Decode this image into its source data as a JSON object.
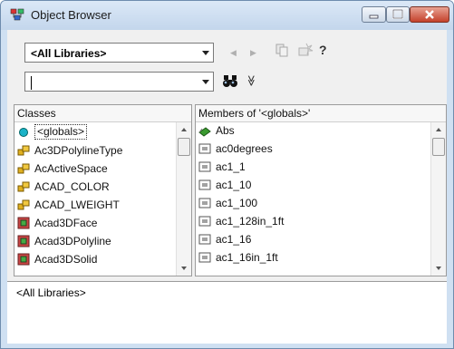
{
  "window": {
    "title": "Object Browser"
  },
  "toolbar": {
    "library_select": "<All Libraries>",
    "search_value": "",
    "back_glyph": "◀",
    "forward_glyph": "▶",
    "copy_icon": "copy-icon",
    "view_definition_icon": "view-definition-icon",
    "help_glyph": "?",
    "search_icon": "binoculars-icon",
    "toggle_glyph": "≫"
  },
  "classes": {
    "header": "Classes",
    "items": [
      {
        "label": "<globals>",
        "icon": "globals-icon"
      },
      {
        "label": "Ac3DPolylineType",
        "icon": "enum-icon"
      },
      {
        "label": "AcActiveSpace",
        "icon": "enum-icon"
      },
      {
        "label": "ACAD_COLOR",
        "icon": "enum-icon"
      },
      {
        "label": "ACAD_LWEIGHT",
        "icon": "enum-icon"
      },
      {
        "label": "Acad3DFace",
        "icon": "class-icon"
      },
      {
        "label": "Acad3DPolyline",
        "icon": "class-icon"
      },
      {
        "label": "Acad3DSolid",
        "icon": "class-icon"
      }
    ]
  },
  "members": {
    "header": "Members of '<globals>'",
    "items": [
      {
        "label": "Abs",
        "icon": "method-icon"
      },
      {
        "label": "ac0degrees",
        "icon": "constant-icon"
      },
      {
        "label": "ac1_1",
        "icon": "constant-icon"
      },
      {
        "label": "ac1_10",
        "icon": "constant-icon"
      },
      {
        "label": "ac1_100",
        "icon": "constant-icon"
      },
      {
        "label": "ac1_128in_1ft",
        "icon": "constant-icon"
      },
      {
        "label": "ac1_16",
        "icon": "constant-icon"
      },
      {
        "label": "ac1_16in_1ft",
        "icon": "constant-icon"
      }
    ]
  },
  "details": {
    "text": "<All Libraries>"
  },
  "colors": {
    "accent": "#3a7bd5",
    "close": "#c4412b",
    "frame": "#cfe0f2"
  }
}
